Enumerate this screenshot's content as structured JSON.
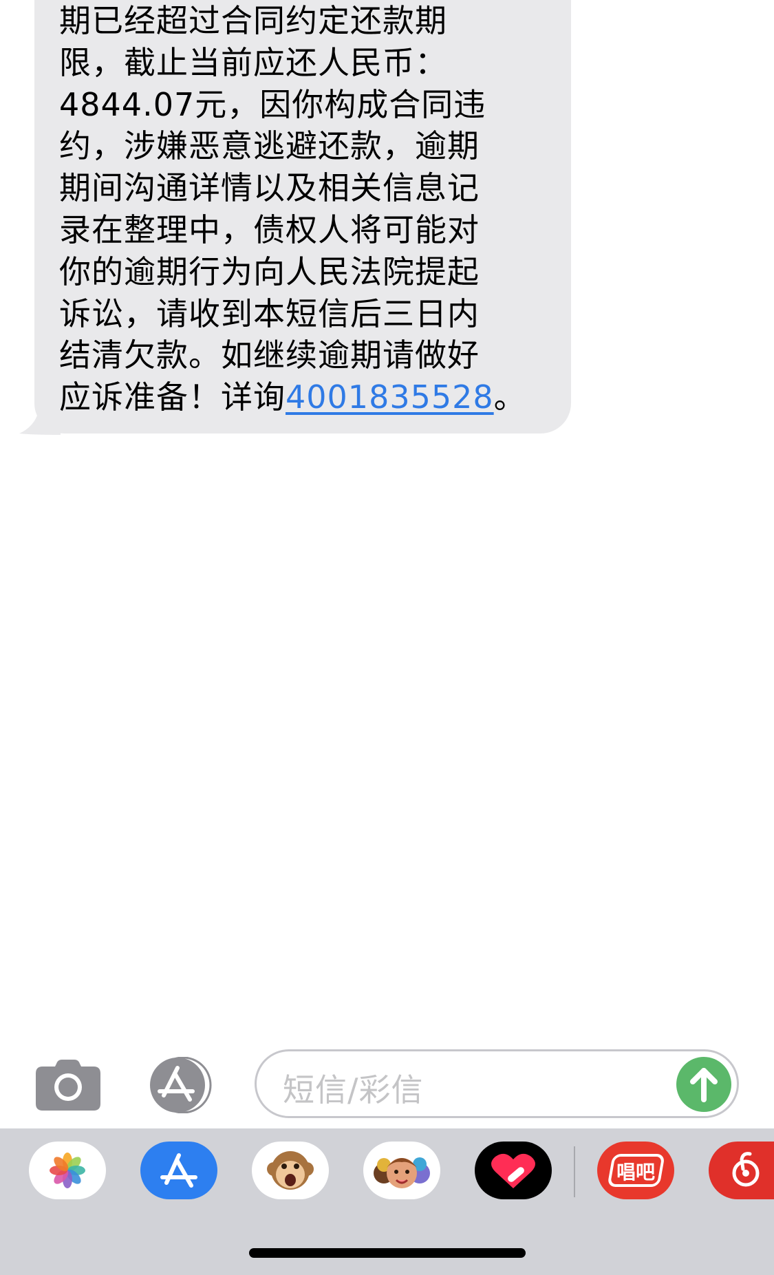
{
  "message": {
    "lines": [
      "期已经超过合同约定还款期",
      "限，截止当前应还人民币：",
      "4844.07元，因你构成合同违",
      "约，涉嫌恶意逃避还款，逾期",
      "期间沟通详情以及相关信息记",
      "录在整理中，债权人将可能对",
      "你的逾期行为向人民法院提起",
      "诉讼，请收到本短信后三日内",
      "结清欠款。如继续逾期请做好"
    ],
    "last_line_prefix": "应诉准备！详询",
    "phone_link": "4001835528",
    "last_line_suffix": "。"
  },
  "input_bar": {
    "camera_icon": "camera-icon",
    "apps_icon": "app-store-icon",
    "placeholder": "短信/彩信",
    "send_icon": "send-arrow-icon",
    "send_color": "#5bb86a"
  },
  "app_drawer": {
    "apps": [
      {
        "name": "photos",
        "icon": "photos-icon"
      },
      {
        "name": "app-store",
        "icon": "app-store-icon"
      },
      {
        "name": "animoji",
        "icon": "monkey-icon"
      },
      {
        "name": "memoji",
        "icon": "memoji-icon"
      },
      {
        "name": "digital-touch",
        "icon": "heart-icon"
      },
      {
        "name": "changba",
        "icon": "changba-icon",
        "label": "唱吧"
      },
      {
        "name": "netease-music",
        "icon": "netease-music-icon"
      }
    ]
  },
  "colors": {
    "bubble": "#e9e9eb",
    "link": "#2f7ae5",
    "drawer": "#d1d2d7"
  }
}
